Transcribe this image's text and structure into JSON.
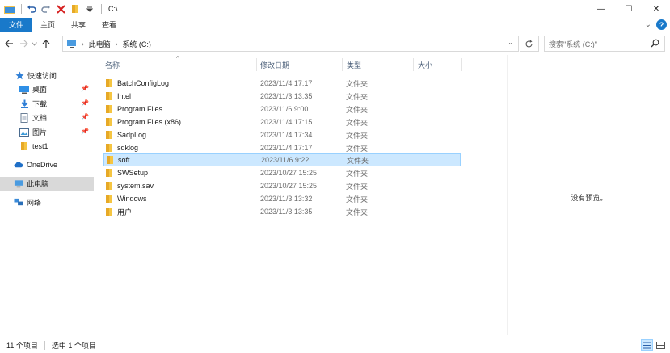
{
  "title_bar": {
    "path": "C:\\",
    "controls": {
      "minimize": "—",
      "maximize": "☐",
      "close": "✕"
    }
  },
  "ribbon": {
    "tabs": [
      "文件",
      "主页",
      "共享",
      "查看"
    ],
    "help": "?",
    "expand": "⌄"
  },
  "address_bar": {
    "breadcrumbs": [
      "此电脑",
      "系统 (C:)"
    ],
    "search_placeholder": "搜索\"系统 (C:)\""
  },
  "sidebar": {
    "quick_access": "快速访问",
    "quick_items": [
      {
        "label": "桌面",
        "icon": "desktop-icon",
        "pinned": true
      },
      {
        "label": "下载",
        "icon": "download-icon",
        "pinned": true
      },
      {
        "label": "文档",
        "icon": "documents-icon",
        "pinned": true
      },
      {
        "label": "图片",
        "icon": "pictures-icon",
        "pinned": true
      },
      {
        "label": "test1",
        "icon": "folder-icon",
        "pinned": false
      }
    ],
    "onedrive": "OneDrive",
    "this_pc": "此电脑",
    "network": "网络"
  },
  "file_list": {
    "columns": {
      "name": "名称",
      "date": "修改日期",
      "type": "类型",
      "size": "大小"
    },
    "rows": [
      {
        "name": "BatchConfigLog",
        "date": "2023/11/4 17:17",
        "type": "文件夹"
      },
      {
        "name": "Intel",
        "date": "2023/11/3 13:35",
        "type": "文件夹"
      },
      {
        "name": "Program Files",
        "date": "2023/11/6 9:00",
        "type": "文件夹"
      },
      {
        "name": "Program Files (x86)",
        "date": "2023/11/4 17:15",
        "type": "文件夹"
      },
      {
        "name": "SadpLog",
        "date": "2023/11/4 17:34",
        "type": "文件夹"
      },
      {
        "name": "sdklog",
        "date": "2023/11/4 17:17",
        "type": "文件夹"
      },
      {
        "name": "soft",
        "date": "2023/11/6 9:22",
        "type": "文件夹",
        "selected": true
      },
      {
        "name": "SWSetup",
        "date": "2023/10/27 15:25",
        "type": "文件夹"
      },
      {
        "name": "system.sav",
        "date": "2023/10/27 15:25",
        "type": "文件夹"
      },
      {
        "name": "Windows",
        "date": "2023/11/3 13:32",
        "type": "文件夹"
      },
      {
        "name": "用户",
        "date": "2023/11/3 13:35",
        "type": "文件夹"
      }
    ]
  },
  "preview": {
    "text": "没有预览。"
  },
  "status_bar": {
    "count": "11 个项目",
    "selected": "选中 1 个项目"
  },
  "colors": {
    "accent": "#1979ca",
    "folder": "#f5c542",
    "selection_bg": "#cce8ff",
    "selection_border": "#99d1ff"
  }
}
